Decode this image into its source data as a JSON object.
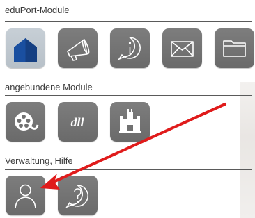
{
  "sections": [
    {
      "title": "eduPort-Module",
      "tiles": [
        {
          "icon": "home-icon",
          "active": true
        },
        {
          "icon": "megaphone-icon"
        },
        {
          "icon": "info-icon"
        },
        {
          "icon": "envelope-icon"
        },
        {
          "icon": "folder-icon"
        }
      ]
    },
    {
      "title": "angebundene Module",
      "tiles": [
        {
          "icon": "film-reel-icon"
        },
        {
          "icon": "dll-logo-icon"
        },
        {
          "icon": "castle-icon"
        }
      ]
    },
    {
      "title": "Verwaltung, Hilfe",
      "tiles": [
        {
          "icon": "user-icon"
        },
        {
          "icon": "help-icon"
        }
      ]
    }
  ],
  "logo_text": "dll",
  "colors": {
    "tile": "#717171",
    "tile_active": "#c3cbd2",
    "home_blue": "#1a4fa0",
    "annotation_arrow": "#e01b1b"
  }
}
